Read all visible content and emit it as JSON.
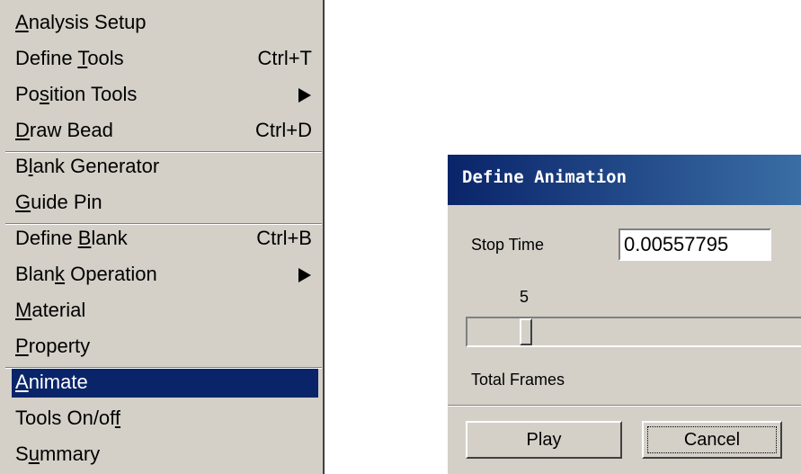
{
  "menu": {
    "items": [
      {
        "label": "Analysis Setup",
        "shortcut": "",
        "submenu": false,
        "ul": 0,
        "selected": false
      },
      {
        "label": "Define Tools",
        "shortcut": "Ctrl+T",
        "submenu": false,
        "ul": 7,
        "selected": false
      },
      {
        "label": "Position Tools",
        "shortcut": "",
        "submenu": true,
        "ul": 2,
        "selected": false
      },
      {
        "label": "Draw Bead",
        "shortcut": "Ctrl+D",
        "submenu": false,
        "ul": 0,
        "selected": false
      },
      {
        "label": "Blank Generator",
        "shortcut": "",
        "submenu": false,
        "ul": 1,
        "selected": false
      },
      {
        "label": "Guide Pin",
        "shortcut": "",
        "submenu": false,
        "ul": 0,
        "selected": false
      },
      {
        "label": "Define Blank",
        "shortcut": "Ctrl+B",
        "submenu": false,
        "ul": 7,
        "selected": false
      },
      {
        "label": "Blank Operation",
        "shortcut": "",
        "submenu": true,
        "ul": 4,
        "selected": false
      },
      {
        "label": "Material",
        "shortcut": "",
        "submenu": false,
        "ul": 0,
        "selected": false
      },
      {
        "label": "Property",
        "shortcut": "",
        "submenu": false,
        "ul": 0,
        "selected": false
      },
      {
        "label": "Animate",
        "shortcut": "",
        "submenu": false,
        "ul": 0,
        "selected": true
      },
      {
        "label": "Tools On/off",
        "shortcut": "",
        "submenu": false,
        "ul": 11,
        "selected": false
      },
      {
        "label": "Summary",
        "shortcut": "",
        "submenu": false,
        "ul": 1,
        "selected": false
      }
    ],
    "selected_color": "#0a246a"
  },
  "dialog": {
    "title": "Define Animation",
    "stop_time_label": "Stop Time",
    "stop_time_value": "0.00557795",
    "slider_value": "5",
    "total_frames_label": "Total Frames",
    "play_label": "Play",
    "cancel_label": "Cancel"
  }
}
